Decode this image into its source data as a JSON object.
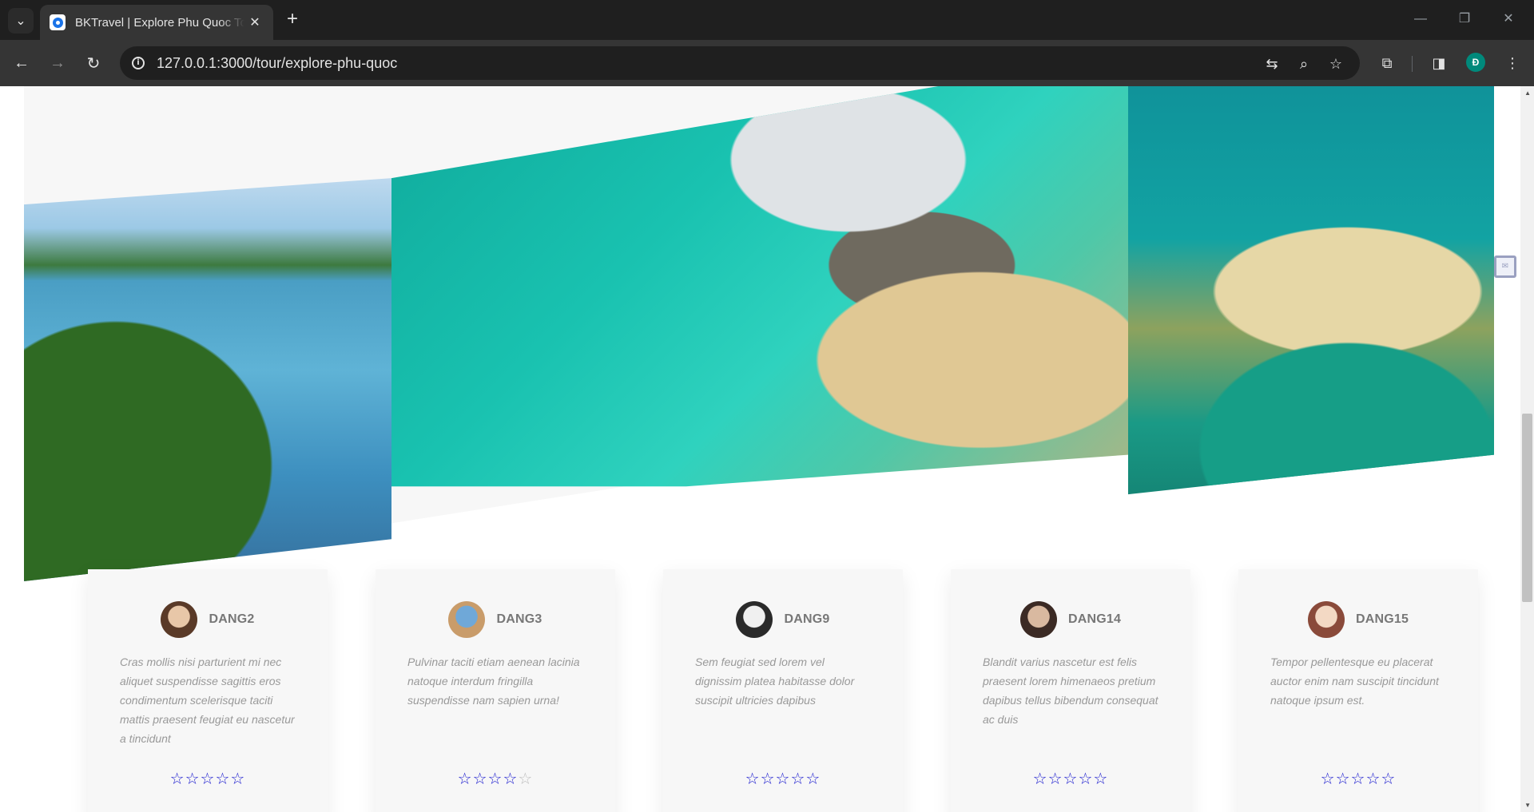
{
  "browser": {
    "tab_title": "BKTravel | Explore Phu Quoc Tour",
    "url": "127.0.0.1:3000/tour/explore-phu-quoc",
    "profile_initial": "Đ",
    "icons": {
      "tab_search": "chevron-down-icon",
      "tab_close": "close-icon",
      "new_tab": "plus-icon",
      "back": "arrow-left-icon",
      "forward": "arrow-right-icon",
      "reload": "reload-icon",
      "site_info": "info-icon",
      "translate": "translate-icon",
      "zoom": "zoom-icon",
      "bookmark": "star-icon",
      "extensions": "puzzle-icon",
      "side_panel": "side-panel-icon",
      "menu": "kebab-menu-icon",
      "minimize": "minimize-icon",
      "restore": "restore-icon",
      "close_window": "close-icon"
    }
  },
  "gallery": {
    "photos": [
      {
        "subject": "bay-with-boats"
      },
      {
        "subject": "beach-resort-villas"
      },
      {
        "subject": "aerial-lagoon"
      }
    ]
  },
  "reviews": [
    {
      "name": "DANG2",
      "text": "Cras mollis nisi parturient mi nec aliquet suspendisse sagittis eros condimentum scelerisque taciti mattis praesent feugiat eu nascetur a tincidunt",
      "rating": 5,
      "avatar_colors": [
        "#e8c7a8",
        "#5a3a28"
      ]
    },
    {
      "name": "DANG3",
      "text": "Pulvinar taciti etiam aenean lacinia natoque interdum fringilla suspendisse nam sapien urna!",
      "rating": 4,
      "avatar_colors": [
        "#6fa8d8",
        "#c99c6a"
      ]
    },
    {
      "name": "DANG9",
      "text": "Sem feugiat sed lorem vel dignissim platea habitasse dolor suscipit ultricies dapibus",
      "rating": 5,
      "avatar_colors": [
        "#f0f0f0",
        "#2a2a2a"
      ]
    },
    {
      "name": "DANG14",
      "text": "Blandit varius nascetur est felis praesent lorem himenaeos pretium dapibus tellus bibendum consequat ac duis",
      "rating": 5,
      "avatar_colors": [
        "#d9b9a0",
        "#3b2a24"
      ]
    },
    {
      "name": "DANG15",
      "text": "Tempor pellentesque eu placerat auctor enim nam suscipit tincidunt natoque ipsum est.",
      "rating": 5,
      "avatar_colors": [
        "#f3d9c4",
        "#8a4a3a"
      ]
    }
  ]
}
